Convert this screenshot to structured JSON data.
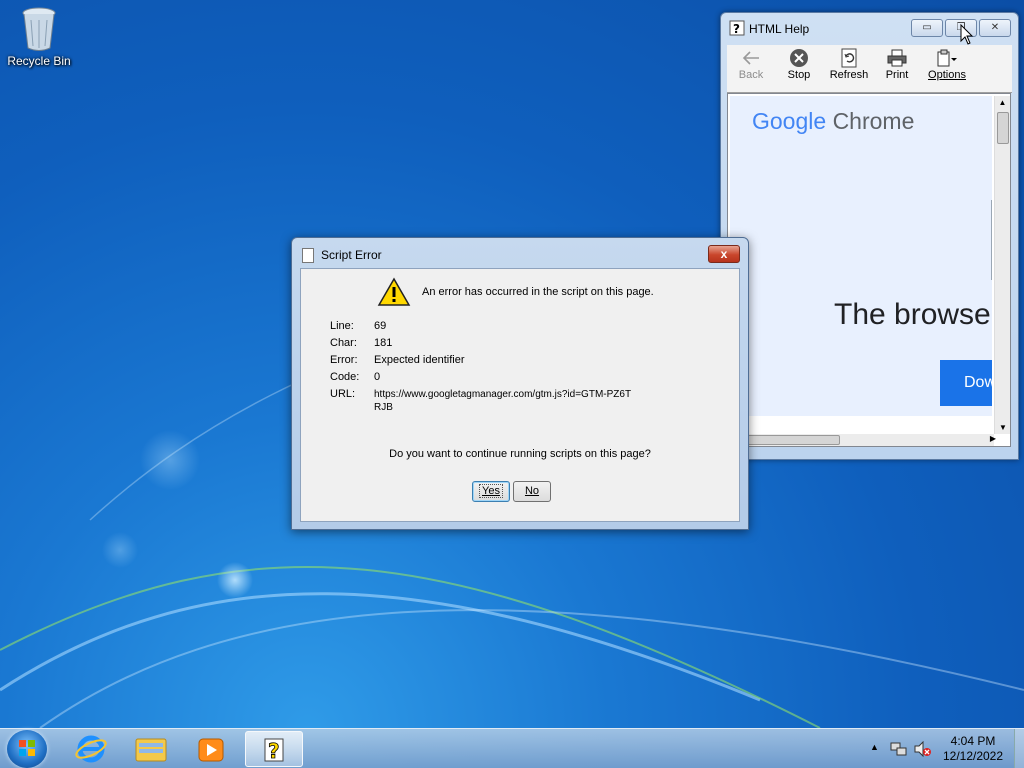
{
  "desktop": {
    "recycle_bin_label": "Recycle Bin"
  },
  "help_window": {
    "title": "HTML Help",
    "toolbar": [
      {
        "label": "Back",
        "icon": "back-arrow-icon",
        "enabled": false
      },
      {
        "label": "Stop",
        "icon": "stop-icon",
        "enabled": true
      },
      {
        "label": "Refresh",
        "icon": "refresh-icon",
        "enabled": true
      },
      {
        "label": "Print",
        "icon": "printer-icon",
        "enabled": true
      },
      {
        "label": "Options",
        "icon": "options-icon",
        "enabled": true
      }
    ],
    "content": {
      "logo_google": "Google",
      "logo_chrome": "Chrome",
      "headline": "The browse",
      "download_button": "Dow"
    }
  },
  "error_dialog": {
    "title": "Script Error",
    "message": "An error has occurred in the script on this page.",
    "fields": {
      "line_label": "Line:",
      "line_value": "69",
      "char_label": "Char:",
      "char_value": "181",
      "error_label": "Error:",
      "error_value": "Expected identifier",
      "code_label": "Code:",
      "code_value": "0",
      "url_label": "URL:",
      "url_value": "https://www.googletagmanager.com/gtm.js?id=GTM-PZ6TRJB"
    },
    "question": "Do you want to continue running scripts on this page?",
    "yes_label": "Yes",
    "no_label": "No",
    "close_label": "x"
  },
  "taskbar": {
    "apps": [
      {
        "name": "internet-explorer",
        "icon": "internet-explorer-icon"
      },
      {
        "name": "windows-explorer",
        "icon": "folder-icon"
      },
      {
        "name": "media-player",
        "icon": "media-player-icon"
      },
      {
        "name": "html-help",
        "icon": "help-icon",
        "active": true
      }
    ],
    "clock_time": "4:04 PM",
    "clock_date": "12/12/2022"
  },
  "colors": {
    "accent_blue": "#1a73e8",
    "close_red": "#c9462c"
  }
}
